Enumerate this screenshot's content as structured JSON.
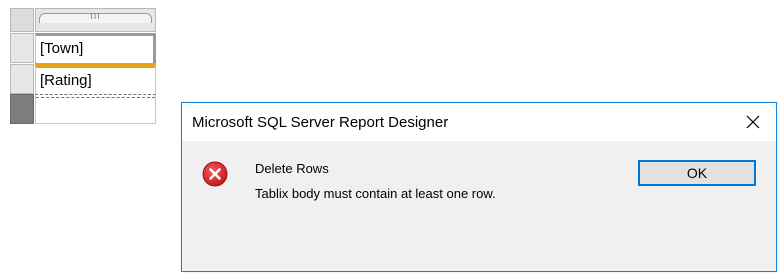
{
  "tablix": {
    "column_handle_grip": "III",
    "rows": [
      {
        "text": "[Town]"
      },
      {
        "text": "[Rating]"
      },
      {
        "text": ""
      }
    ],
    "colors": {
      "selected_row_border": "#e8a21a",
      "row_handle_selected": "#7d7d7d"
    }
  },
  "dialog": {
    "title": "Microsoft SQL Server Report Designer",
    "close_icon": "close-icon",
    "message_icon": "error-icon",
    "message_title": "Delete Rows",
    "message_body": "Tablix body must contain at least one row.",
    "ok_label": "OK",
    "colors": {
      "border": "#1883d7",
      "button_focus_border": "#0078d7",
      "error_icon": "#e81123"
    }
  }
}
